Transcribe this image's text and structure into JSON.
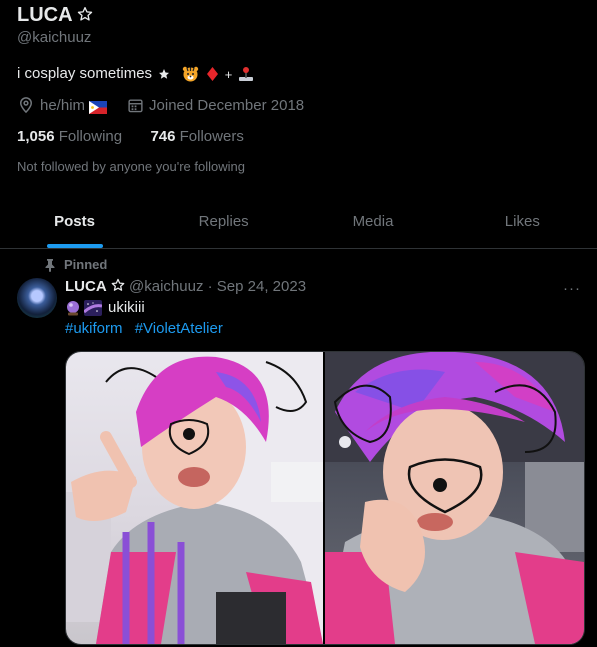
{
  "profile": {
    "name": "LUCA",
    "handle": "@kaichuuz",
    "bio": "i cosplay sometimes",
    "pronouns": "he/him",
    "joined": "Joined December 2018",
    "following_count": "1,056",
    "following_label": "Following",
    "followers_count": "746",
    "followers_label": "Followers",
    "not_followed_text": "Not followed by anyone you're following"
  },
  "tabs": [
    {
      "label": "Posts",
      "active": true
    },
    {
      "label": "Replies"
    },
    {
      "label": "Media"
    },
    {
      "label": "Likes"
    }
  ],
  "post": {
    "pinned_label": "Pinned",
    "author": "LUCA",
    "handle": "@kaichuuz",
    "date": "Sep 24, 2023",
    "text": "ukikiii",
    "hashtags": [
      "#ukiform",
      "#VioletAtelier"
    ],
    "more_label": "···"
  },
  "colors": {
    "background": "#000000",
    "text": "#e7e9ea",
    "muted": "#71767b",
    "accent": "#1d9bf0",
    "border": "#2f3336"
  },
  "icons": [
    "star-icon",
    "tiger-emoji-icon",
    "red-diamond-icon",
    "joystick-emoji-icon",
    "location-icon",
    "philippines-flag-icon",
    "calendar-icon",
    "pin-icon",
    "crystal-ball-icon",
    "milky-way-icon",
    "more-icon"
  ]
}
